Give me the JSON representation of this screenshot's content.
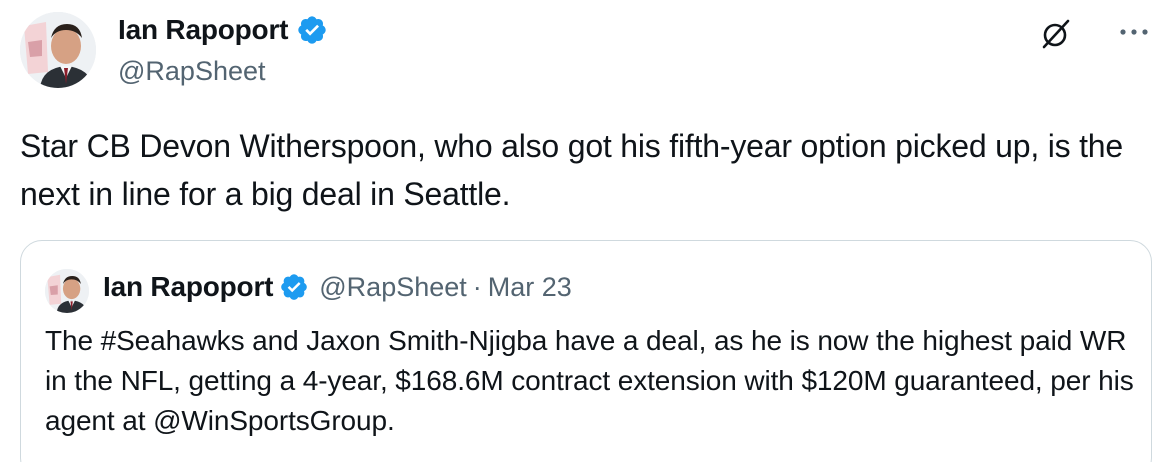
{
  "tweet": {
    "author": {
      "name": "Ian Rapoport",
      "handle": "@RapSheet",
      "avatar_icon": "profile-photo-icon",
      "verified_icon": "verified-badge-icon"
    },
    "text": "Star CB Devon Witherspoon, who also got his fifth-year option picked up, is the next in line for a big deal in Seattle.",
    "actions": {
      "grok_icon": "grok-icon",
      "more_icon": "more-options-icon"
    }
  },
  "quoted_tweet": {
    "author": {
      "name": "Ian Rapoport",
      "handle": "@RapSheet",
      "avatar_icon": "profile-photo-icon",
      "verified_icon": "verified-badge-icon"
    },
    "separator": "·",
    "date": "Mar 23",
    "text": "The #Seahawks and Jaxon Smith-Njigba have a deal, as he is now the highest paid WR in the NFL, getting a 4-year, $168.6M contract extension with $120M guaranteed, per his agent at @WinSportsGroup."
  },
  "colors": {
    "text_primary": "#0f1419",
    "text_secondary": "#536471",
    "verified_blue": "#1d9bf0",
    "border": "#cfd9de"
  }
}
